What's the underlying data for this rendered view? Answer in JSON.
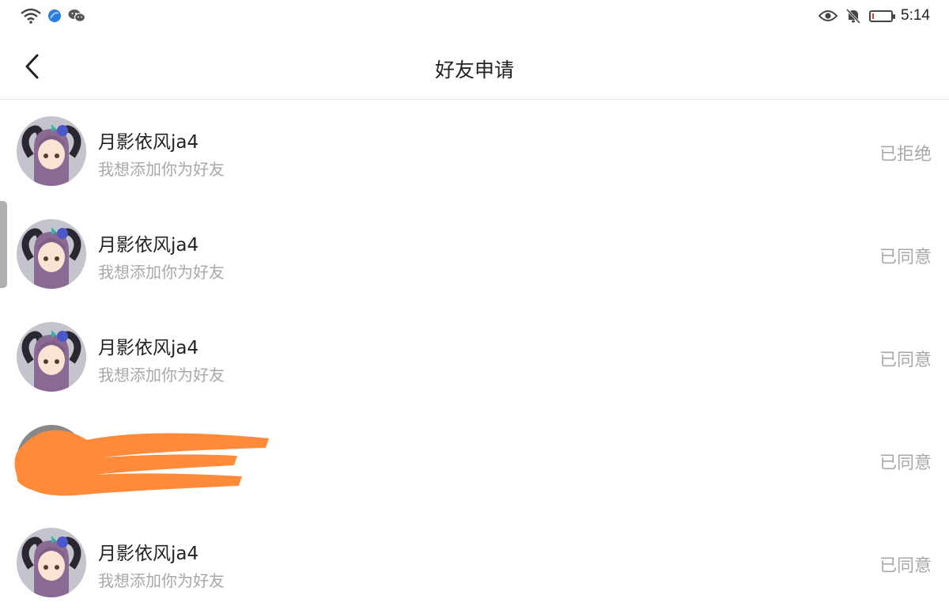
{
  "status_bar": {
    "time": "5:14",
    "left_icons": [
      "wifi-icon",
      "browser-app-icon",
      "wechat-icon"
    ],
    "right_icons": [
      "eye-icon",
      "bell-muted-icon",
      "battery-icon"
    ]
  },
  "header": {
    "title": "好友申请",
    "back_icon": "chevron-left-icon"
  },
  "requests": [
    {
      "name": "月影依风ja4",
      "message": "我想添加你为好友",
      "status": "已拒绝",
      "redacted": false
    },
    {
      "name": "月影依风ja4",
      "message": "我想添加你为好友",
      "status": "已同意",
      "redacted": false
    },
    {
      "name": "月影依风ja4",
      "message": "我想添加你为好友",
      "status": "已同意",
      "redacted": false
    },
    {
      "name": "",
      "message": "",
      "status": "已同意",
      "redacted": true
    },
    {
      "name": "月影依风ja4",
      "message": "我想添加你为好友",
      "status": "已同意",
      "redacted": false
    }
  ],
  "colors": {
    "redaction": "#ff8a3a",
    "muted_text": "#a8a8a8",
    "divider": "#e6e6e6"
  }
}
